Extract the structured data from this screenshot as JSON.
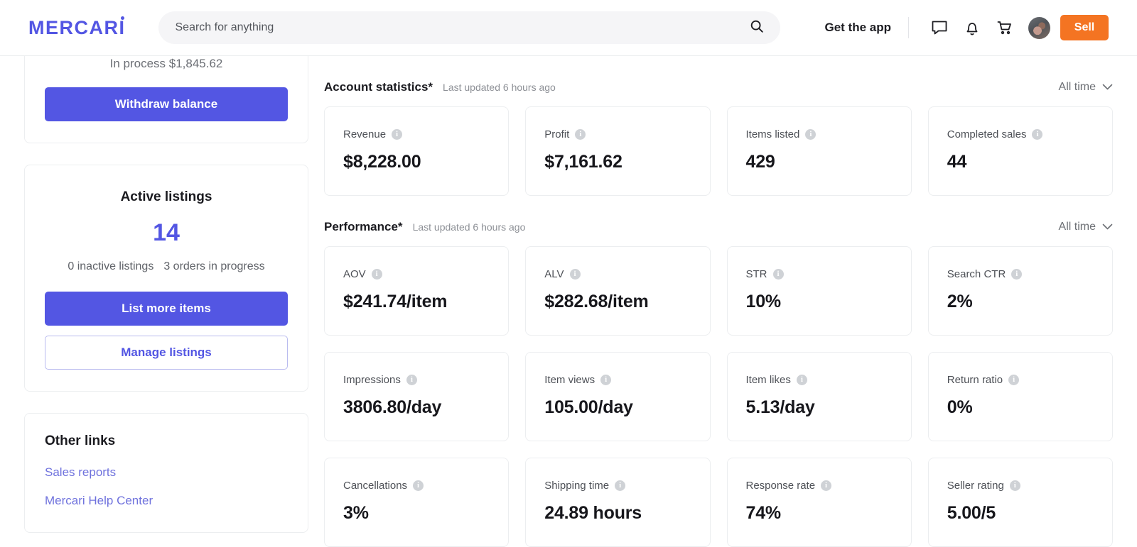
{
  "header": {
    "logo_main": "MERCARI",
    "search": {
      "placeholder": "Search for anything",
      "value": ""
    },
    "get_app_label": "Get the app",
    "sell_label": "Sell",
    "icons": [
      "chat-icon",
      "bell-icon",
      "cart-icon",
      "avatar"
    ]
  },
  "sidebar": {
    "balance": {
      "in_process": "In process $1,845.62",
      "withdraw_label": "Withdraw balance"
    },
    "listings": {
      "title": "Active listings",
      "count": "14",
      "inactive": "0 inactive listings",
      "in_progress": "3 orders in progress",
      "list_more_label": "List more items",
      "manage_label": "Manage listings"
    },
    "other_links": {
      "title": "Other links",
      "links": [
        "Sales reports",
        "Mercari Help Center"
      ]
    }
  },
  "main": {
    "account_statistics": {
      "title": "Account statistics*",
      "updated": "Last updated 6 hours ago",
      "range": "All time",
      "stats": [
        {
          "label": "Revenue",
          "value": "$8,228.00"
        },
        {
          "label": "Profit",
          "value": "$7,161.62"
        },
        {
          "label": "Items listed",
          "value": "429"
        },
        {
          "label": "Completed sales",
          "value": "44"
        }
      ]
    },
    "performance": {
      "title": "Performance*",
      "updated": "Last updated 6 hours ago",
      "range": "All time",
      "stats": [
        {
          "label": "AOV",
          "value": "$241.74/item"
        },
        {
          "label": "ALV",
          "value": "$282.68/item"
        },
        {
          "label": "STR",
          "value": "10%"
        },
        {
          "label": "Search CTR",
          "value": "2%"
        },
        {
          "label": "Impressions",
          "value": "3806.80/day"
        },
        {
          "label": "Item views",
          "value": "105.00/day"
        },
        {
          "label": "Item likes",
          "value": "5.13/day"
        },
        {
          "label": "Return ratio",
          "value": "0%"
        },
        {
          "label": "Cancellations",
          "value": "3%"
        },
        {
          "label": "Shipping time",
          "value": "24.89 hours"
        },
        {
          "label": "Response rate",
          "value": "74%"
        },
        {
          "label": "Seller rating",
          "value": "5.00/5"
        }
      ]
    }
  },
  "colors": {
    "brand_purple": "#5356e3",
    "sell_orange": "#f47422",
    "border": "#eceef0"
  }
}
